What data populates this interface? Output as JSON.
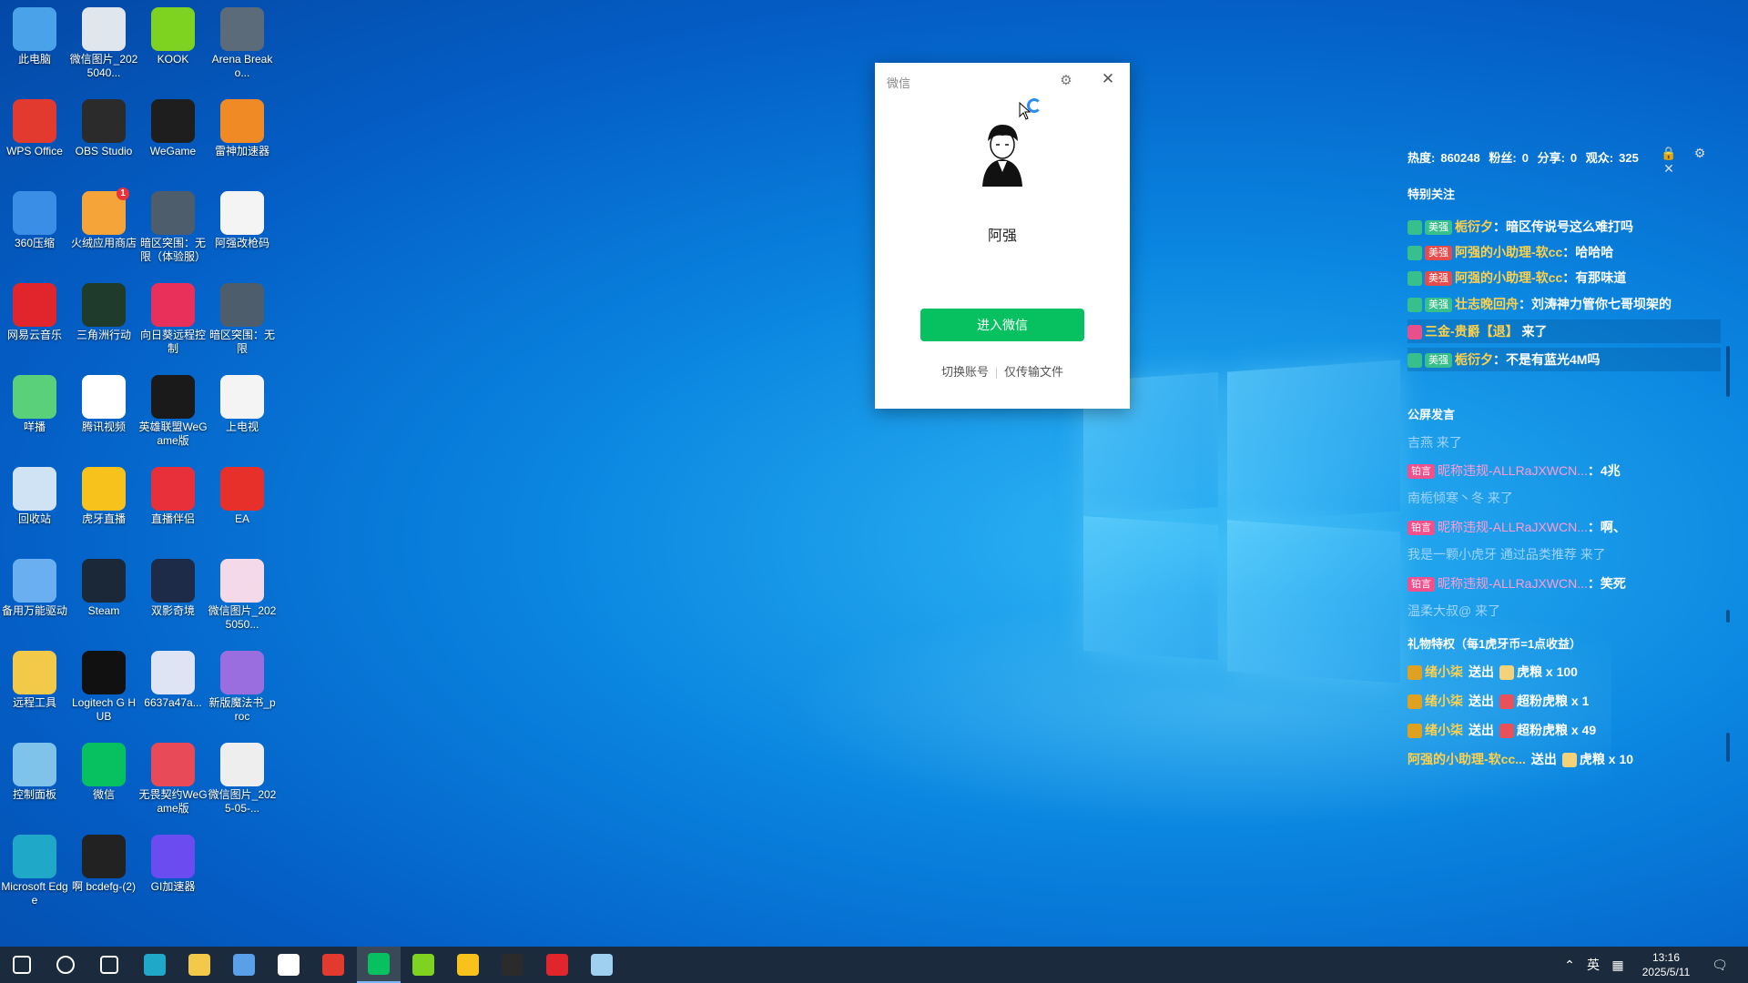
{
  "desktop_icons": [
    {
      "label": "此电脑",
      "icon": "computer-icon",
      "color": "#4aa3e8"
    },
    {
      "label": "微信图片_2025040...",
      "icon": "image-file-icon",
      "color": "#dfe6ee"
    },
    {
      "label": "KOOK",
      "icon": "kook-icon",
      "color": "#7ed321"
    },
    {
      "label": "Arena Breako...",
      "icon": "game-icon",
      "color": "#5b6b7a"
    },
    {
      "label": "WPS Office",
      "icon": "wps-icon",
      "color": "#e33a2f"
    },
    {
      "label": "OBS Studio",
      "icon": "obs-icon",
      "color": "#2b2b2b"
    },
    {
      "label": "WeGame",
      "icon": "wegame-icon",
      "color": "#1e1e1e"
    },
    {
      "label": "雷神加速器",
      "icon": "accelerator-icon",
      "color": "#f08a24"
    },
    {
      "label": "360压缩",
      "icon": "archive-icon",
      "color": "#3a8ee6"
    },
    {
      "label": "火绒应用商店",
      "icon": "store-icon",
      "color": "#f5a43a",
      "badge": "1"
    },
    {
      "label": "暗区突围：无限（体验服）",
      "icon": "game-icon",
      "color": "#4e5d6b"
    },
    {
      "label": "阿强改枪码",
      "icon": "text-file-icon",
      "color": "#f4f4f4"
    },
    {
      "label": "网易云音乐",
      "icon": "music-icon",
      "color": "#e0262c"
    },
    {
      "label": "三角洲行动",
      "icon": "delta-icon",
      "color": "#1e3b2c"
    },
    {
      "label": "向日葵远程控制",
      "icon": "remote-icon",
      "color": "#e8305a"
    },
    {
      "label": "暗区突围：无限",
      "icon": "game-icon",
      "color": "#4e5d6b"
    },
    {
      "label": "咩播",
      "icon": "miebo-icon",
      "color": "#5ad07a"
    },
    {
      "label": "腾讯视频",
      "icon": "video-icon",
      "color": "#ffffff"
    },
    {
      "label": "英雄联盟WeGame版",
      "icon": "lol-icon",
      "color": "#1a1a1a"
    },
    {
      "label": "上电视",
      "icon": "spreadsheet-icon",
      "color": "#f4f4f4"
    },
    {
      "label": "回收站",
      "icon": "recycle-bin-icon",
      "color": "#cfe3f5"
    },
    {
      "label": "虎牙直播",
      "icon": "huya-icon",
      "color": "#f7c21c"
    },
    {
      "label": "直播伴侣",
      "icon": "live-assistant-icon",
      "color": "#e8303a"
    },
    {
      "label": "EA",
      "icon": "ea-icon",
      "color": "#e8302a"
    },
    {
      "label": "备用万能驱动",
      "icon": "driver-icon",
      "color": "#6ab0f0"
    },
    {
      "label": "Steam",
      "icon": "steam-icon",
      "color": "#1b2838"
    },
    {
      "label": "双影奇境",
      "icon": "sf-icon",
      "color": "#1d2a48"
    },
    {
      "label": "微信图片_2025050...",
      "icon": "image-file-icon",
      "color": "#f4d9e8"
    },
    {
      "label": "远程工具",
      "icon": "folder-icon",
      "color": "#f3c94a"
    },
    {
      "label": "Logitech G HUB",
      "icon": "logitech-icon",
      "color": "#111111"
    },
    {
      "label": "6637a47a...",
      "icon": "shield-emblem-icon",
      "color": "#dfe4f5"
    },
    {
      "label": "新版魔法书_proc",
      "icon": "magic-book-icon",
      "color": "#9b6ee0"
    },
    {
      "label": "控制面板",
      "icon": "control-panel-icon",
      "color": "#7fc2ea"
    },
    {
      "label": "微信",
      "icon": "wechat-icon",
      "color": "#07c160"
    },
    {
      "label": "无畏契约WeGame版",
      "icon": "valorant-icon",
      "color": "#e84a57"
    },
    {
      "label": "微信图片_2025-05-...",
      "icon": "image-file-icon",
      "color": "#eeeeee"
    },
    {
      "label": "Microsoft Edge",
      "icon": "edge-icon",
      "color": "#1fa8c8"
    },
    {
      "label": "啊 bcdefg-(2)",
      "icon": "shortcut-icon",
      "color": "#222222"
    },
    {
      "label": "GI加速器",
      "icon": "gi-accelerator-icon",
      "color": "#6b4cf0"
    }
  ],
  "wechat": {
    "title": "微信",
    "name": "阿强",
    "login_button": "进入微信",
    "switch_account": "切换账号",
    "transfer_only": "仅传输文件",
    "accent": "#07c160"
  },
  "live": {
    "stats": {
      "heat_label": "热度:",
      "heat": "860248",
      "fans_label": "粉丝:",
      "fans": "0",
      "share_label": "分享:",
      "share": "0",
      "viewers_label": "观众:",
      "viewers": "325"
    },
    "special_title": "特别关注",
    "special": [
      {
        "tag": "美强",
        "nick": "栀衍夕",
        "msg": "：暗区传说号这么难打吗"
      },
      {
        "tag": "美强",
        "nick": "阿强的小助理-软cc",
        "msg": "：哈哈哈"
      },
      {
        "tag": "美强",
        "nick": "阿强的小助理-软cc",
        "msg": "：有那味道"
      },
      {
        "tag": "美强",
        "nick": "壮志晚回舟",
        "msg": "：刘涛神力管你七哥坝架的"
      },
      {
        "tag": "",
        "nick": "三金-贵爵【退】",
        "msg": " 来了"
      },
      {
        "tag": "美强",
        "nick": "栀衍夕",
        "msg": "：不是有蓝光4M吗"
      }
    ],
    "public_title": "公屏发言",
    "public": [
      {
        "kind": "enter",
        "text": "吉燕 来了"
      },
      {
        "kind": "chat",
        "tag": "铂言",
        "nick": "昵称违规-ALLRaJXWCN...",
        "msg": "：4兆"
      },
      {
        "kind": "enter",
        "text": "南栀倾寒丶冬 来了"
      },
      {
        "kind": "chat",
        "tag": "铂言",
        "nick": "昵称违规-ALLRaJXWCN...",
        "msg": "：啊、"
      },
      {
        "kind": "enter",
        "text": "我是一颗小虎牙 通过品类推荐 来了"
      },
      {
        "kind": "chat",
        "tag": "铂言",
        "nick": "昵称违规-ALLRaJXWCN...",
        "msg": "：笑死"
      },
      {
        "kind": "enter",
        "text": "温柔大叔@ 来了"
      }
    ],
    "gift_title": "礼物特权（每1虎牙币=1点收益）",
    "gifts": [
      {
        "nick": "绪小柒",
        "action": "送出",
        "gift": "虎粮 x 100"
      },
      {
        "nick": "绪小柒",
        "action": "送出",
        "gift": "超粉虎粮 x 1"
      },
      {
        "nick": "绪小柒",
        "action": "送出",
        "gift": "超粉虎粮 x 49"
      },
      {
        "nick": "阿强的小助理-软cc...",
        "action": "送出",
        "gift": "虎粮 x 10"
      }
    ]
  },
  "taskbar": {
    "apps": [
      {
        "icon": "start-icon",
        "color": "#ffffff"
      },
      {
        "icon": "search-icon",
        "color": "#ffffff"
      },
      {
        "icon": "task-view-icon",
        "color": "#ffffff"
      },
      {
        "icon": "edge-icon",
        "color": "#1fa8c8"
      },
      {
        "icon": "file-explorer-icon",
        "color": "#f3c94a"
      },
      {
        "icon": "store-icon",
        "color": "#5aa0e8"
      },
      {
        "icon": "mail-icon",
        "color": "#ffffff"
      },
      {
        "icon": "wps-icon",
        "color": "#e33a2f"
      },
      {
        "icon": "wechat-icon",
        "color": "#07c160",
        "active": true
      },
      {
        "icon": "kook-icon",
        "color": "#7ed321"
      },
      {
        "icon": "huya-icon",
        "color": "#f7c21c"
      },
      {
        "icon": "obs-icon",
        "color": "#2b2b2b"
      },
      {
        "icon": "music-icon",
        "color": "#e0262c"
      },
      {
        "icon": "notepad-icon",
        "color": "#9fd0f0"
      }
    ],
    "ime": "英",
    "time": "13:16",
    "date": "2025/5/11"
  }
}
